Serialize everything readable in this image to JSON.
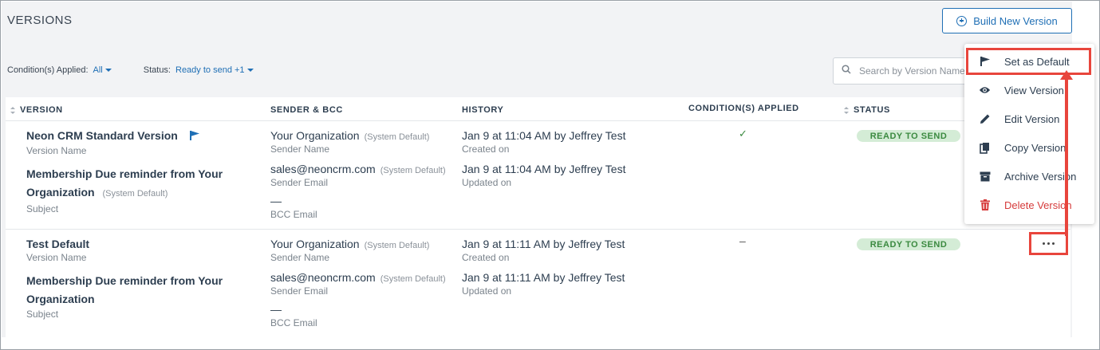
{
  "header": {
    "title": "VERSIONS",
    "build_button_label": "Build New Version"
  },
  "filters": {
    "conditions_label": "Condition(s) Applied:",
    "conditions_value": "All",
    "status_label": "Status:",
    "status_value": "Ready to send +1"
  },
  "search": {
    "placeholder": "Search by Version Name"
  },
  "columns": {
    "version": "VERSION",
    "sender": "SENDER & BCC",
    "history": "HISTORY",
    "conditions": "CONDITION(S) APPLIED",
    "status": "STATUS"
  },
  "rows": [
    {
      "version_name": "Neon CRM Standard Version",
      "version_name_label": "Version Name",
      "subject_line1": "Membership Due reminder from Your",
      "subject_line2": "Organization",
      "subject_suffix": "(System Default)",
      "subject_label": "Subject",
      "sender_name": "Your Organization",
      "sender_name_suffix": "(System Default)",
      "sender_name_label": "Sender Name",
      "sender_email": "sales@neoncrm.com",
      "sender_email_suffix": "(System Default)",
      "sender_email_label": "Sender Email",
      "bcc_value": "—",
      "bcc_label": "BCC Email",
      "created": "Jan 9 at 11:04 AM by Jeffrey Test",
      "created_label": "Created on",
      "updated": "Jan 9 at 11:04 AM by Jeffrey Test",
      "updated_label": "Updated on",
      "conditions_value": "✓",
      "status": "READY TO SEND",
      "is_default": true
    },
    {
      "version_name": "Test Default",
      "version_name_label": "Version Name",
      "subject_line1": "Membership Due reminder from Your",
      "subject_line2": "Organization",
      "subject_label": "Subject",
      "sender_name": "Your Organization",
      "sender_name_suffix": "(System Default)",
      "sender_name_label": "Sender Name",
      "sender_email": "sales@neoncrm.com",
      "sender_email_suffix": "(System Default)",
      "sender_email_label": "Sender Email",
      "bcc_value": "—",
      "bcc_label": "BCC Email",
      "created": "Jan 9 at 11:11 AM by Jeffrey Test",
      "created_label": "Created on",
      "updated": "Jan 9 at 11:11 AM by Jeffrey Test",
      "updated_label": "Updated on",
      "conditions_value": "–",
      "status": "READY TO SEND",
      "is_default": false
    }
  ],
  "menu": {
    "items": [
      {
        "label": "Set as Default",
        "icon": "flag-icon"
      },
      {
        "label": "View Version",
        "icon": "eye-icon"
      },
      {
        "label": "Edit Version",
        "icon": "pencil-icon"
      },
      {
        "label": "Copy Version",
        "icon": "copy-icon"
      },
      {
        "label": "Archive Version",
        "icon": "archive-icon"
      },
      {
        "label": "Delete Version",
        "icon": "trash-icon"
      }
    ]
  },
  "colors": {
    "accent": "#1f6fb5",
    "status_bg": "#d4ecd6",
    "status_text": "#3b8a40",
    "danger": "#d63b3b",
    "annotation": "#e8453c"
  }
}
